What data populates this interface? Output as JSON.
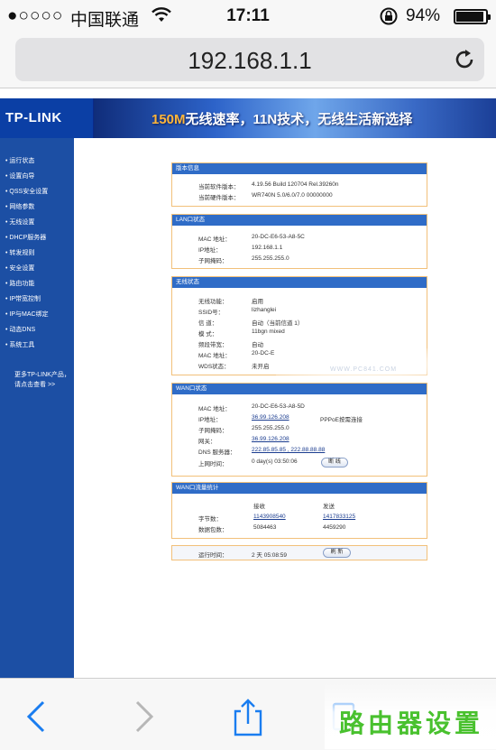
{
  "status_bar": {
    "signal": "●○○○○",
    "carrier": "中国联通",
    "wifi_icon": "wifi-icon",
    "time": "17:11",
    "lock_icon": "orientation-lock-icon",
    "battery_pct": "94%",
    "battery_level": 0.94
  },
  "browser": {
    "url": "192.168.1.1",
    "reload_icon": "reload-icon"
  },
  "router": {
    "logo": "TP-LINK",
    "slogan_speed": "150M",
    "slogan_rest": "无线速率，11N技术，无线生活新选择",
    "menu": [
      "运行状态",
      "设置向导",
      "QSS安全设置",
      "网络参数",
      "无线设置",
      "DHCP服务器",
      "转发规则",
      "安全设置",
      "路由功能",
      "IP带宽控制",
      "IP与MAC绑定",
      "动态DNS",
      "系统工具"
    ],
    "more_line1": "更多TP-LINK产品，",
    "more_line2": "请点击查看 >>",
    "version": {
      "title": "版本信息",
      "sw_label": "当前软件版本：",
      "sw_value": "4.19.56 Build 120704 Rel.39260n",
      "hw_label": "当前硬件版本：",
      "hw_value": "WR740N 5.0/6.0/7.0 00000000"
    },
    "lan": {
      "title": "LAN口状态",
      "mac_label": "MAC 地址：",
      "mac_value": "20-DC-E6-53-A8-5C",
      "ip_label": "IP地址：",
      "ip_value": "192.168.1.1",
      "mask_label": "子网掩码：",
      "mask_value": "255.255.255.0"
    },
    "wireless": {
      "title": "无线状态",
      "func_label": "无线功能：",
      "func_value": "启用",
      "ssid_label": "SSID号：",
      "ssid_value": "lizhanglei",
      "channel_label": "信 道：",
      "channel_value": "自动（当前信道 1）",
      "mode_label": "模 式：",
      "mode_value": "11bgn mixed",
      "bw_label": "频段带宽：",
      "bw_value": "自动",
      "mac_label": "MAC 地址：",
      "mac_value": "20-DC-E",
      "wds_label": "WDS状态：",
      "wds_value": "未开启"
    },
    "wan": {
      "title": "WAN口状态",
      "mac_label": "MAC 地址：",
      "mac_value": "20-DC-E6-53-A8-5D",
      "ip_label": "IP地址：",
      "ip_value": "36.99.126.208",
      "ip_note": "PPPoE按需连接",
      "mask_label": "子网掩码：",
      "mask_value": "255.255.255.0",
      "gw_label": "网关：",
      "gw_value": "36.99.126.208",
      "dns_label": "DNS 服务器：",
      "dns_value": "222.85.85.85 , 222.88.88.88",
      "online_label": "上网时间：",
      "online_value": "0 day(s) 03:50:06",
      "disconnect_btn": "断 线"
    },
    "traffic": {
      "title": "WAN口流量统计",
      "recv_header": "接收",
      "send_header": "发送",
      "bytes_label": "字节数：",
      "bytes_recv": "1143908540",
      "bytes_send": "1417833125",
      "pkts_label": "数据包数：",
      "pkts_recv": "5084463",
      "pkts_send": "4459290"
    },
    "runtime": {
      "label": "运行时间：",
      "value": "2 天 05:08:59",
      "refresh_btn": "刷 新"
    },
    "watermark": "WWW.PC841.COM"
  },
  "toolbar": {
    "back_icon": "back-icon",
    "forward_icon": "forward-icon",
    "share_icon": "share-icon",
    "tabs_icon": "tabs-icon",
    "brand": "路由器设置"
  }
}
